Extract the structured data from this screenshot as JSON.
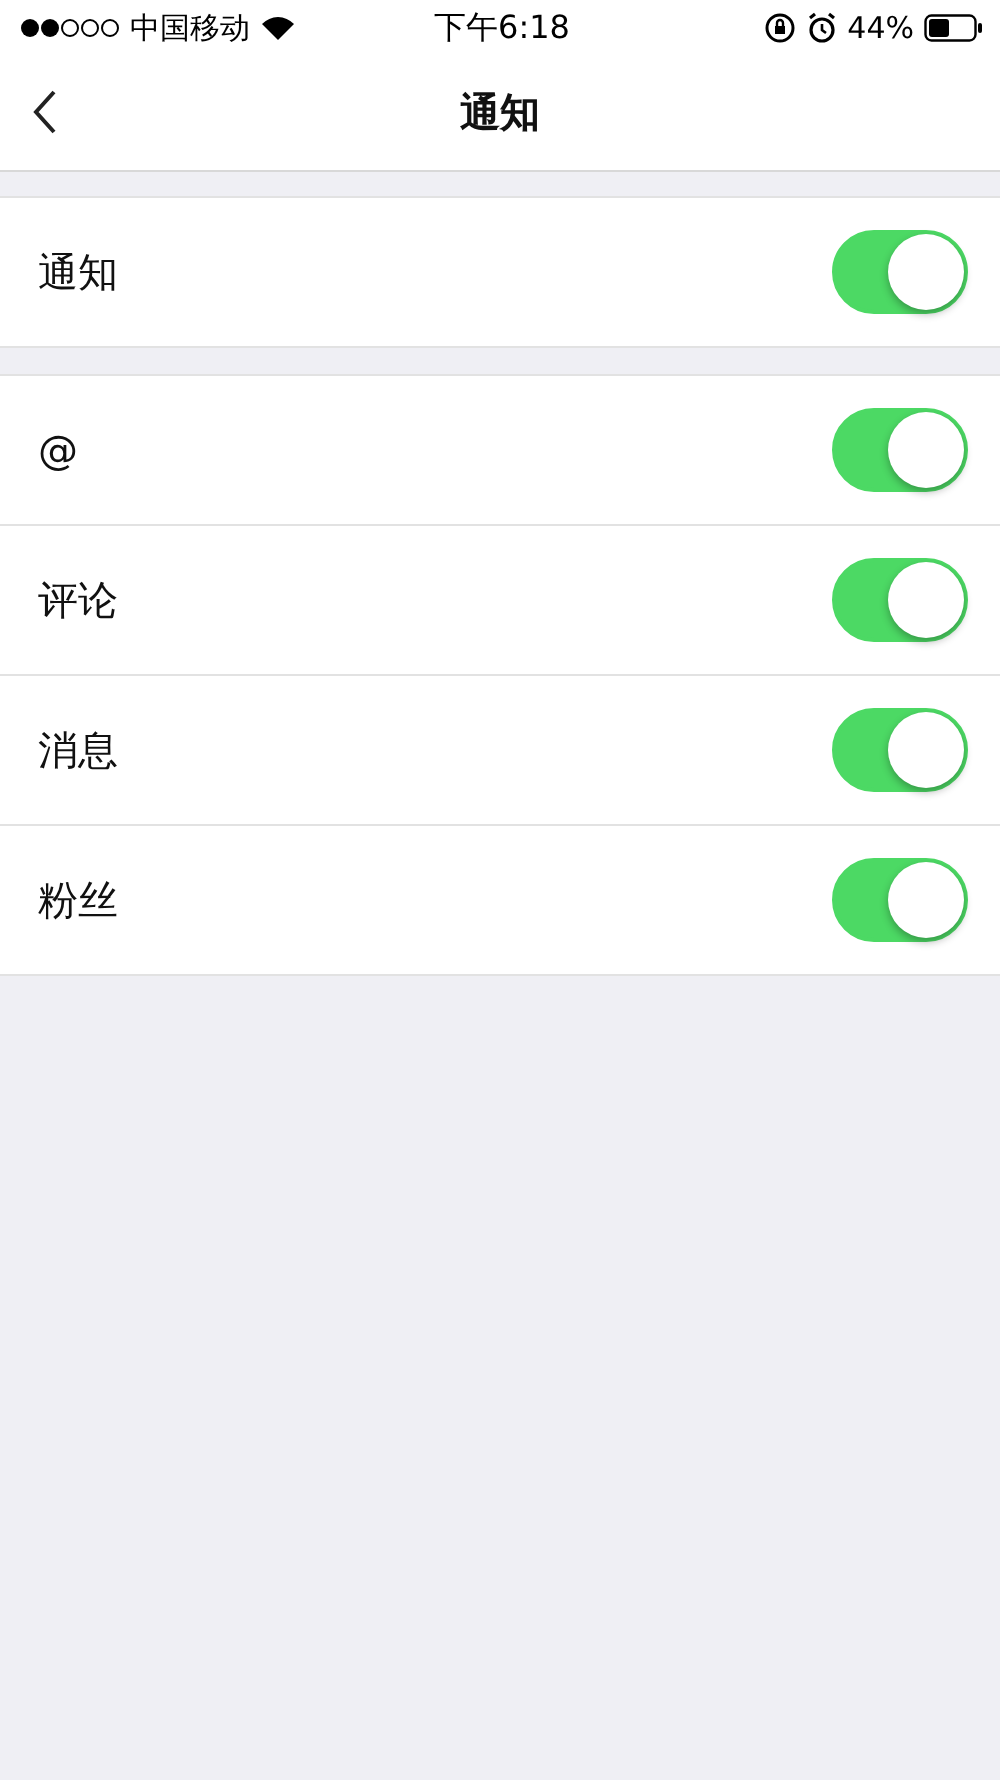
{
  "status_bar": {
    "carrier": "中国移动",
    "time": "下午6:18",
    "battery": "44%"
  },
  "nav": {
    "title": "通知"
  },
  "sections": [
    {
      "rows": [
        {
          "label": "通知",
          "on": true
        }
      ]
    },
    {
      "rows": [
        {
          "label": "@",
          "on": true
        },
        {
          "label": "评论",
          "on": true
        },
        {
          "label": "消息",
          "on": true
        },
        {
          "label": "粉丝",
          "on": true
        }
      ]
    }
  ]
}
